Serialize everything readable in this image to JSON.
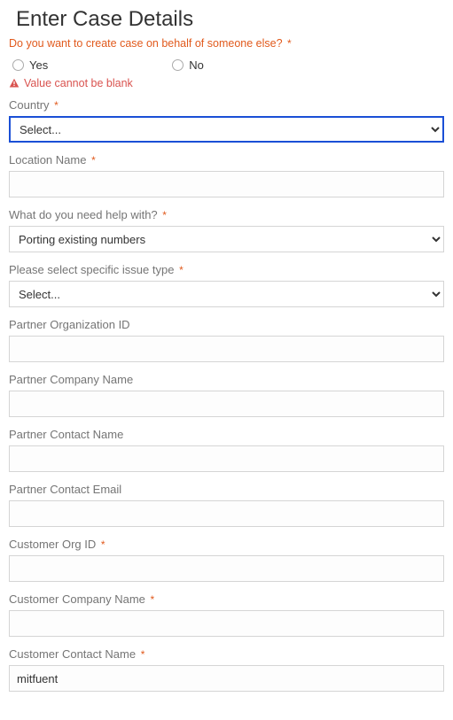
{
  "heading": "Enter Case Details",
  "behalf": {
    "question": "Do you want to create case on behalf of someone else?",
    "options": {
      "yes": "Yes",
      "no": "No"
    },
    "error": "Value cannot be blank"
  },
  "fields": {
    "country": {
      "label": "Country",
      "required": true,
      "value": "Select...",
      "highlight": true
    },
    "location_name": {
      "label": "Location Name",
      "required": true,
      "value": ""
    },
    "help_with": {
      "label": "What do you need help with?",
      "required": true,
      "value": "Porting existing numbers"
    },
    "issue_type": {
      "label": "Please select specific issue type",
      "required": true,
      "value": "Select..."
    },
    "partner_org_id": {
      "label": "Partner Organization ID",
      "required": false,
      "value": ""
    },
    "partner_company": {
      "label": "Partner Company Name",
      "required": false,
      "value": ""
    },
    "partner_contact_name": {
      "label": "Partner Contact Name",
      "required": false,
      "value": ""
    },
    "partner_contact_email": {
      "label": "Partner Contact Email",
      "required": false,
      "value": ""
    },
    "customer_org_id": {
      "label": "Customer Org ID",
      "required": true,
      "value": ""
    },
    "customer_company": {
      "label": "Customer Company Name",
      "required": true,
      "value": ""
    },
    "customer_contact_name": {
      "label": "Customer Contact Name",
      "required": true,
      "value": "mitfuent"
    }
  },
  "star": "*"
}
